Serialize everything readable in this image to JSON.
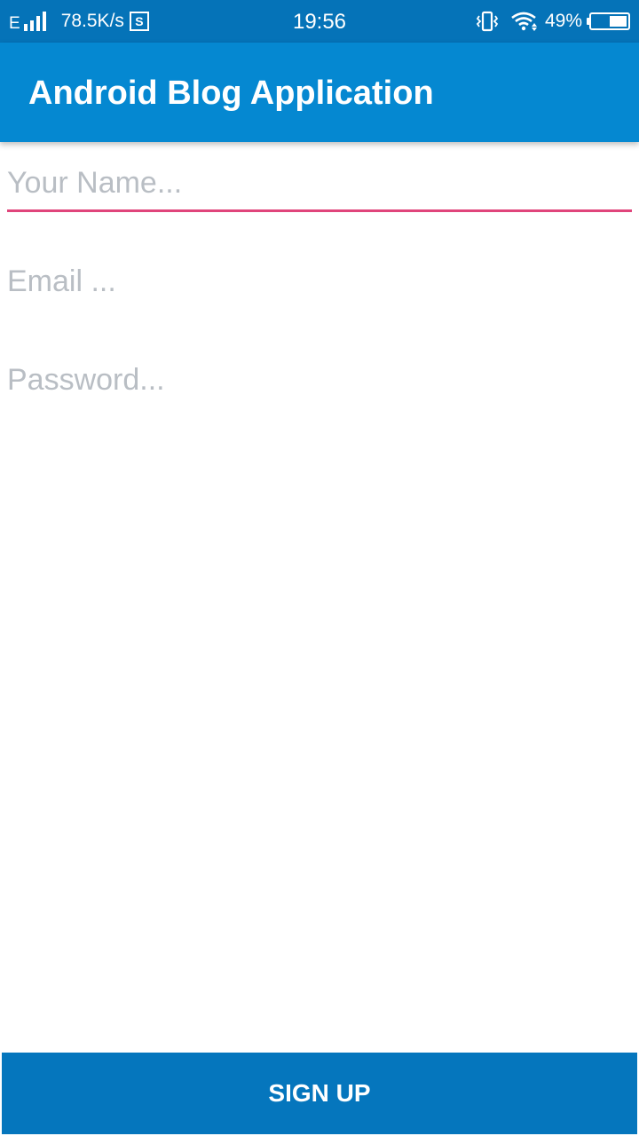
{
  "status_bar": {
    "network_type": "E",
    "speed": "78.5K/s",
    "s_icon": "S",
    "time": "19:56",
    "battery_percent": "49%",
    "battery_level": 0.49
  },
  "app_bar": {
    "title": "Android Blog Application",
    "color": "#0588d1"
  },
  "form": {
    "name_placeholder": "Your Name...",
    "email_placeholder": "Email ...",
    "password_placeholder": "Password...",
    "focus_color": "#e0457b"
  },
  "signup_button": {
    "label": "SIGN UP",
    "color": "#0576bd"
  }
}
